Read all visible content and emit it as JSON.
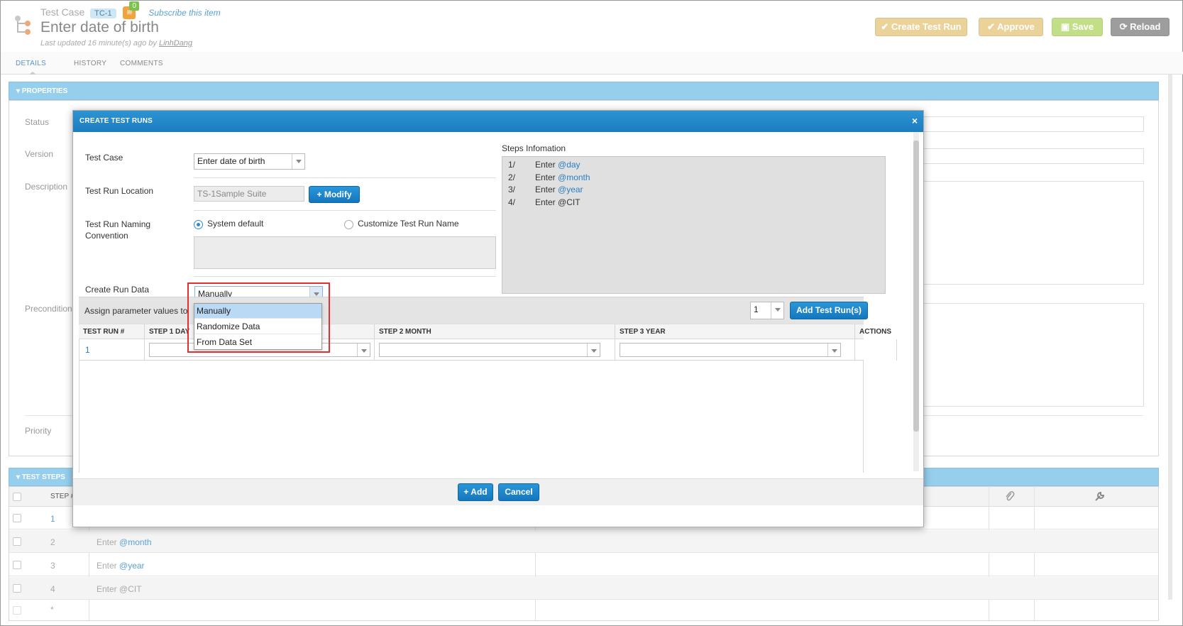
{
  "header": {
    "breadcrumb": "Test Case",
    "badge": "TC-1",
    "rss_count": "0",
    "subscribe": "Subscribe this item",
    "title": "Enter date of birth",
    "updated_prefix": "Last updated 16 minute(s) ago by ",
    "updated_user": "LinhDang",
    "buttons": {
      "create_test_run": "Create Test Run",
      "approve": "Approve",
      "save": "Save",
      "reload": "Reload"
    },
    "colors": {
      "create": "#e8c97a",
      "approve": "#e8c97a",
      "save": "#b5d96e",
      "reload": "#8a8a8a"
    }
  },
  "tabs": [
    "DETAILS",
    "HISTORY",
    "COMMENTS"
  ],
  "properties": {
    "header": "PROPERTIES",
    "labels": {
      "status": "Status",
      "version": "Version",
      "description": "Description",
      "precondition": "Precondition",
      "priority": "Priority"
    }
  },
  "test_steps": {
    "header": "TEST STEPS",
    "col_step": "STEP #",
    "rows": [
      {
        "num": "1",
        "text": "",
        "param": ""
      },
      {
        "num": "2",
        "text": "Enter ",
        "param": "@month"
      },
      {
        "num": "3",
        "text": "Enter ",
        "param": "@year"
      },
      {
        "num": "4",
        "text": "Enter @CIT",
        "param": ""
      },
      {
        "num": "*",
        "text": "",
        "param": ""
      }
    ]
  },
  "modal": {
    "title": "CREATE TEST RUNS",
    "close": "×",
    "labels": {
      "test_case": "Test Case",
      "location": "Test Run Location",
      "naming_line1": "Test Run Naming",
      "naming_line2": "Convention",
      "create_run_data": "Create Run Data",
      "steps_info": "Steps Infomation",
      "assign": "Assign parameter values to"
    },
    "test_case_value": "Enter date of birth",
    "location_value": "TS-1Sample Suite",
    "modify": "Modify",
    "naming": {
      "system_default": "System default",
      "customize": "Customize Test Run Name",
      "selected": "system_default"
    },
    "create_run_data_value": "Manually",
    "dropdown_options": [
      "Manually",
      "Randomize Data",
      "From Data Set"
    ],
    "steps_info": [
      {
        "num": "1/",
        "text": "Enter ",
        "param": "@day"
      },
      {
        "num": "2/",
        "text": "Enter ",
        "param": "@month"
      },
      {
        "num": "3/",
        "text": "Enter ",
        "param": "@year"
      },
      {
        "num": "4/",
        "text": "Enter @CIT",
        "param": ""
      }
    ],
    "count_value": "1",
    "add_test_runs": "Add Test Run(s)",
    "grid_headers": [
      "TEST RUN #",
      "STEP 1 DAY",
      "STEP 2 MONTH",
      "STEP 3 YEAR",
      "ACTIONS"
    ],
    "grid_rows": [
      {
        "run": "1"
      }
    ],
    "add": "+ Add",
    "cancel": "Cancel"
  }
}
